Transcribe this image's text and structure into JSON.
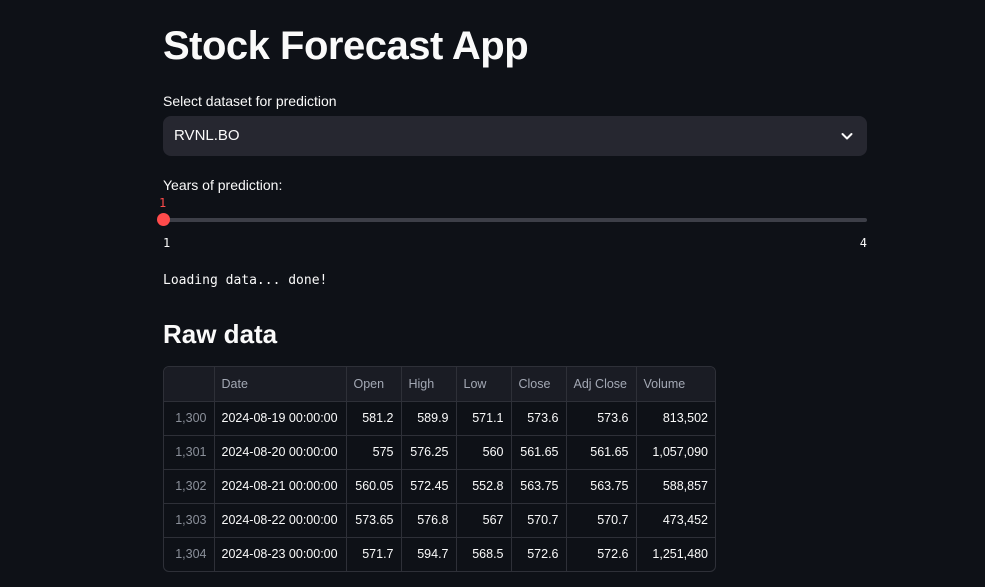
{
  "app": {
    "title": "Stock Forecast App"
  },
  "dataset_select": {
    "label": "Select dataset for prediction",
    "value": "RVNL.BO"
  },
  "years_slider": {
    "label": "Years of prediction:",
    "value": "1",
    "min_label": "1",
    "max_label": "4",
    "min": 1,
    "max": 4,
    "current": 1
  },
  "status": {
    "text": "Loading data... done!"
  },
  "raw_data": {
    "heading": "Raw data",
    "columns": [
      "",
      "Date",
      "Open",
      "High",
      "Low",
      "Close",
      "Adj Close",
      "Volume"
    ],
    "rows": [
      [
        "1,300",
        "2024-08-19 00:00:00",
        "581.2",
        "589.9",
        "571.1",
        "573.6",
        "573.6",
        "813,502"
      ],
      [
        "1,301",
        "2024-08-20 00:00:00",
        "575",
        "576.25",
        "560",
        "561.65",
        "561.65",
        "1,057,090"
      ],
      [
        "1,302",
        "2024-08-21 00:00:00",
        "560.05",
        "572.45",
        "552.8",
        "563.75",
        "563.75",
        "588,857"
      ],
      [
        "1,303",
        "2024-08-22 00:00:00",
        "573.65",
        "576.8",
        "567",
        "570.7",
        "570.7",
        "473,452"
      ],
      [
        "1,304",
        "2024-08-23 00:00:00",
        "571.7",
        "594.7",
        "568.5",
        "572.6",
        "572.6",
        "1,251,480"
      ]
    ]
  },
  "colors": {
    "background": "#0e1117",
    "accent": "#ff4b4b",
    "input_bg": "#262730"
  }
}
